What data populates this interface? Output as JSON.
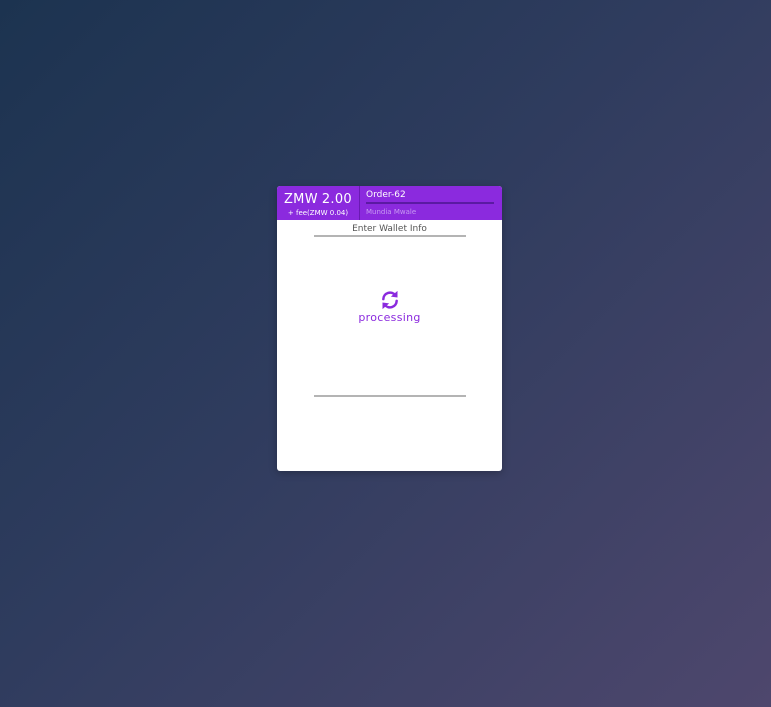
{
  "payment": {
    "currency": "ZMW",
    "amount": "2.00",
    "fee_text": "+ fee(ZMW 0.04)",
    "order_title": "Order-62",
    "customer_name": "Mundia Mwale"
  },
  "wallet": {
    "section_title": "Enter Wallet Info",
    "status_text": "processing",
    "status_icon": "refresh-icon"
  },
  "colors": {
    "accent": "#8b2ade",
    "divider": "#b4b4b4"
  }
}
